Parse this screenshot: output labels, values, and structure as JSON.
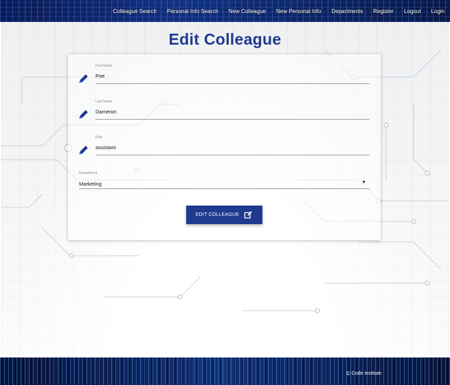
{
  "nav": {
    "links": [
      "Colleague Search",
      "Personal Info Search",
      "New Colleague",
      "New Personal Info",
      "Departments",
      "Register",
      "Logout",
      "Login"
    ]
  },
  "page": {
    "title": "Edit Colleague"
  },
  "form": {
    "first_name": {
      "label": "First Name",
      "value": "Poe"
    },
    "last_name": {
      "label": "Last Name",
      "value": "Dameron"
    },
    "role": {
      "label": "Role",
      "value": "assistant"
    },
    "department": {
      "label": "Department",
      "value": "Marketing"
    },
    "submit_label": "EDIT COLLEAGUE"
  },
  "footer": {
    "text": "Code Institute",
    "copyright_symbol": "©"
  },
  "colors": {
    "primary": "#1f3a8f",
    "nav_bg": "#0c1a55"
  },
  "icons": {
    "field_icon": "pencil-icon",
    "button_icon": "edit-icon"
  }
}
